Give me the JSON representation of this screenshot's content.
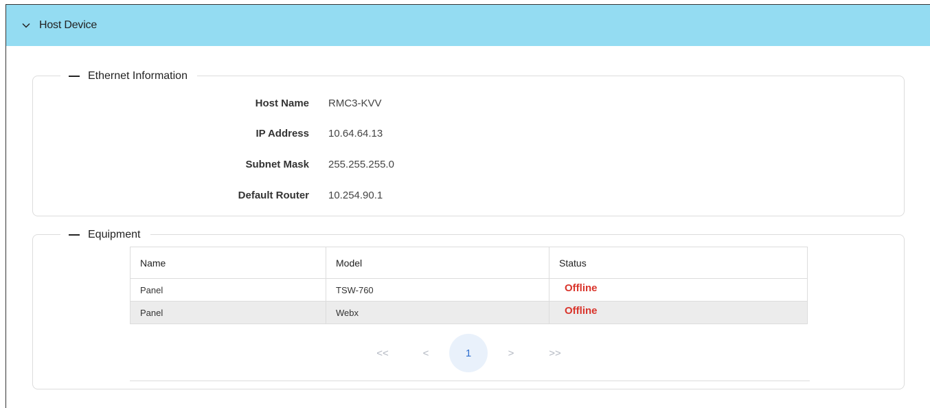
{
  "header": {
    "title": "Host Device"
  },
  "ethernet": {
    "legend": "Ethernet Information",
    "rows": [
      {
        "label": "Host Name",
        "value": "RMC3-KVV"
      },
      {
        "label": "IP Address",
        "value": "10.64.64.13"
      },
      {
        "label": "Subnet Mask",
        "value": "255.255.255.0"
      },
      {
        "label": "Default Router",
        "value": "10.254.90.1"
      }
    ]
  },
  "equipment": {
    "legend": "Equipment",
    "columns": [
      "Name",
      "Model",
      "Status"
    ],
    "rows": [
      {
        "name": "Panel",
        "model": "TSW-760",
        "status": "Offline"
      },
      {
        "name": "Panel",
        "model": "Webx",
        "status": "Offline"
      }
    ],
    "pagination": {
      "first": "<<",
      "prev": "<",
      "current": "1",
      "next": ">",
      "last": ">>"
    }
  },
  "colors": {
    "header_bg": "#94dcf2",
    "offline": "#d9342b",
    "active_page": "#2f6fcf"
  }
}
